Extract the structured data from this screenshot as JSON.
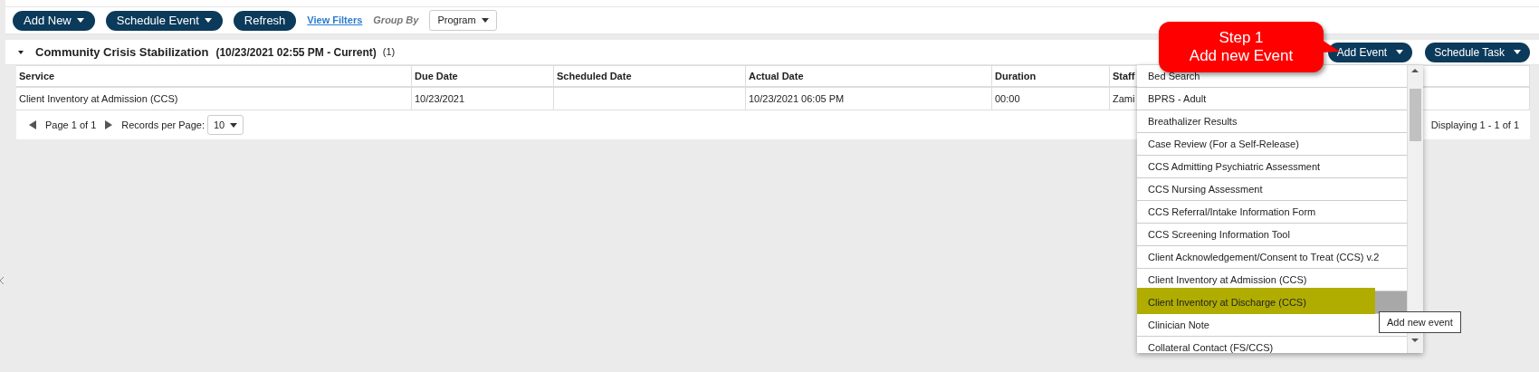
{
  "toolbar": {
    "buttons": [
      {
        "label": "Add New",
        "caret": true
      },
      {
        "label": "Schedule Event",
        "caret": true
      },
      {
        "label": "Refresh",
        "caret": false
      }
    ],
    "link": "View Filters",
    "group_by_label": "Group By",
    "group_by_value": "Program"
  },
  "group": {
    "expanded": true,
    "title": "Community Crisis Stabilization",
    "range": "(10/23/2021 02:55 PM - Current)",
    "count": "(1)",
    "buttons": [
      {
        "label": "Add Event",
        "caret": true
      },
      {
        "label": "Schedule Task",
        "caret": true
      }
    ]
  },
  "table": {
    "columns": [
      "Service",
      "Due Date",
      "Scheduled Date",
      "Actual Date",
      "Duration",
      "Staff"
    ],
    "rows": [
      [
        "Client Inventory at Admission (CCS)",
        "10/23/2021",
        "",
        "10/23/2021 06:05 PM",
        "00:00",
        "Zami"
      ]
    ]
  },
  "pager": {
    "page": "Page 1 of 1",
    "records_label": "Records per Page:",
    "records_value": "10",
    "displaying": "Displaying 1 - 1 of 1"
  },
  "event_menu": {
    "items": [
      {
        "label": "Bed Search",
        "selected": false,
        "highlighted": false
      },
      {
        "label": "BPRS - Adult",
        "selected": false,
        "highlighted": false
      },
      {
        "label": "Breathalizer Results",
        "selected": false,
        "highlighted": false
      },
      {
        "label": "Case Review (For a Self-Release)",
        "selected": false,
        "highlighted": false
      },
      {
        "label": "CCS Admitting Psychiatric Assessment",
        "selected": false,
        "highlighted": false
      },
      {
        "label": "CCS Nursing Assessment",
        "selected": false,
        "highlighted": false
      },
      {
        "label": "CCS Referral/Intake Information Form",
        "selected": false,
        "highlighted": false
      },
      {
        "label": "CCS Screening Information Tool",
        "selected": false,
        "highlighted": false
      },
      {
        "label": "Client Acknowledgement/Consent to Treat (CCS) v.2",
        "selected": false,
        "highlighted": false
      },
      {
        "label": "Client Inventory at Admission (CCS)",
        "selected": false,
        "highlighted": false
      },
      {
        "label": "Client Inventory at Discharge (CCS)",
        "selected": true,
        "highlighted": true
      },
      {
        "label": "Clinician Note",
        "selected": false,
        "highlighted": false
      },
      {
        "label": "Collateral Contact (FS/CCS)",
        "selected": false,
        "highlighted": false
      }
    ],
    "tooltip": "Add new event"
  },
  "callout": {
    "lines": [
      "Step 1",
      "Add new Event"
    ]
  }
}
